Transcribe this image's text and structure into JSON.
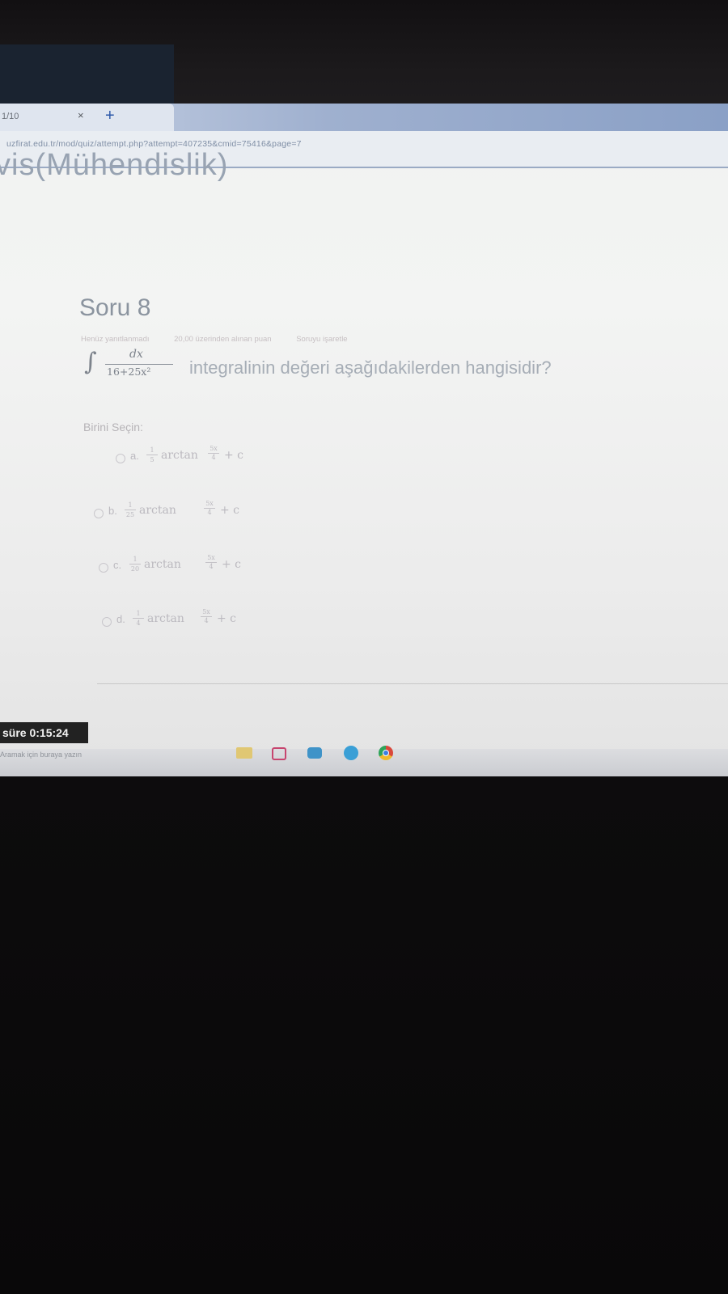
{
  "browser": {
    "tab_title": "1/10",
    "tab_close": "×",
    "new_tab": "+",
    "url": "uzfirat.edu.tr/mod/quiz/attempt.php?attempt=407235&cmid=75416&page=7"
  },
  "course_title": "vis(Mühendislik)",
  "question": {
    "title": "Soru 8",
    "info": [
      "Henüz yanıtlanmadı",
      "20,00 üzerinden alınan puan",
      "Soruyu işaretle"
    ],
    "integral_sign": "∫",
    "numerator": "dx",
    "denominator": "16+25x²",
    "text": "integralinin değeri aşağıdakilerden hangisidir?",
    "prompt": "Birini Seçin:",
    "options": [
      {
        "letter": "a.",
        "coef_num": "1",
        "coef_den": "5",
        "func": "arctan",
        "arg_num": "5x",
        "arg_den": "4",
        "tail": "+ c"
      },
      {
        "letter": "b.",
        "coef_num": "1",
        "coef_den": "25",
        "func": "arctan",
        "arg_num": "5x",
        "arg_den": "4",
        "tail": "+ c"
      },
      {
        "letter": "c.",
        "coef_num": "1",
        "coef_den": "20",
        "func": "arctan",
        "arg_num": "5x",
        "arg_den": "4",
        "tail": "+ c"
      },
      {
        "letter": "d.",
        "coef_num": "1",
        "coef_den": "4",
        "func": "arctan",
        "arg_num": "5x",
        "arg_den": "4",
        "tail": "+ c"
      }
    ]
  },
  "timer": "süre 0:15:24",
  "taskbar": {
    "search_hint": "Aramak için buraya yazın",
    "icons": [
      "folder-icon",
      "mail-icon",
      "store-icon",
      "edge-icon",
      "chrome-icon"
    ]
  }
}
